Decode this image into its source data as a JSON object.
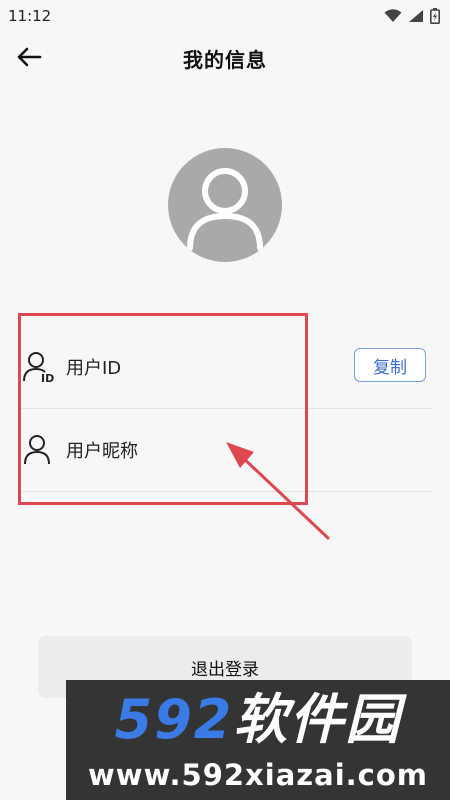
{
  "status_bar": {
    "time": "11:12",
    "icons": [
      "wifi-icon",
      "signal-icon",
      "battery-icon"
    ]
  },
  "header": {
    "back_icon": "arrow-left-icon",
    "title": "我的信息"
  },
  "avatar": {
    "icon": "user-avatar-icon"
  },
  "info_rows": [
    {
      "icon": "user-id-icon",
      "label": "用户ID",
      "action_label": "复制"
    },
    {
      "icon": "user-icon",
      "label": "用户昵称"
    }
  ],
  "logout": {
    "label": "退出登录"
  },
  "annotation": {
    "highlight_color": "#e0484f"
  },
  "watermark": {
    "brand_number": "592",
    "brand_text": "软件园",
    "url": "www.592xiazai.com"
  },
  "colors": {
    "accent": "#3a6fcc",
    "background": "#f7f7f7",
    "avatar": "#a9a9a9"
  }
}
